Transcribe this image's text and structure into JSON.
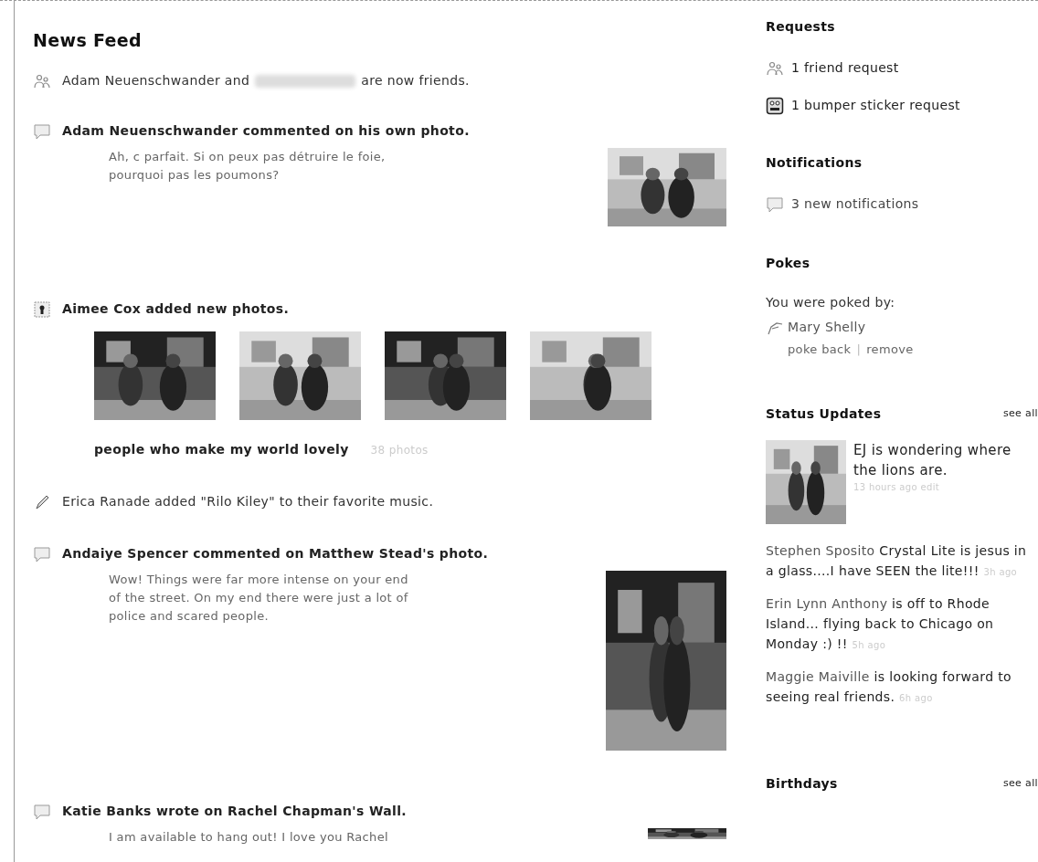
{
  "feed": {
    "title": "News Feed",
    "stories": [
      {
        "kind": "friendship",
        "emphasized": false,
        "before": "Adam Neuenschwander and",
        "after": "are now friends."
      },
      {
        "kind": "comment",
        "emphasized": true,
        "headline": "Adam Neuenschwander commented on his own photo.",
        "comment": "Ah, c parfait. Si on peux pas détruire le foie, pourquoi pas les poumons?"
      },
      {
        "kind": "photos",
        "emphasized": true,
        "headline": "Aimee Cox added new photos.",
        "album": "people who make my world lovely",
        "count": "38 photos"
      },
      {
        "kind": "plain",
        "emphasized": false,
        "headline": "Erica Ranade added \"Rilo Kiley\" to their favorite music."
      },
      {
        "kind": "comment",
        "emphasized": true,
        "headline": "Andaiye Spencer commented on Matthew Stead's photo.",
        "comment": "Wow! Things were far more intense on your end of the street. On my end there were just a lot of police and scared people."
      },
      {
        "kind": "comment",
        "emphasized": true,
        "headline": "Katie Banks wrote on Rachel Chapman's Wall.",
        "comment": "I am available to hang out! I love you Rachel"
      }
    ]
  },
  "sidebar": {
    "requests": {
      "title": "Requests",
      "items": [
        {
          "text": "1 friend request"
        },
        {
          "text": "1 bumper sticker request"
        }
      ]
    },
    "notifications": {
      "title": "Notifications",
      "items": [
        {
          "text": "3 new notifications"
        }
      ]
    },
    "pokes": {
      "title": "Pokes",
      "intro": "You were poked by:",
      "name": "Mary Shelly",
      "actions": [
        "poke back",
        "remove"
      ],
      "separator": "|"
    },
    "status_updates": {
      "title": "Status Updates",
      "see_all": "see all",
      "featured": {
        "text": "EJ is wondering where the lions are.",
        "time": "13 hours ago edit"
      },
      "items": [
        {
          "name": "Stephen Sposito",
          "text": "Crystal Lite is jesus in a glass....I have SEEN the lite!!!",
          "time": "3h ago"
        },
        {
          "name": "Erin Lynn Anthony",
          "text": "is off to Rhode Island... flying back to Chicago on Monday :) !!",
          "time": "5h ago"
        },
        {
          "name": "Maggie Maiville",
          "text": "is looking forward to seeing real friends.",
          "time": "6h ago"
        }
      ]
    },
    "birthdays": {
      "title": "Birthdays",
      "see_all": "see all"
    }
  }
}
